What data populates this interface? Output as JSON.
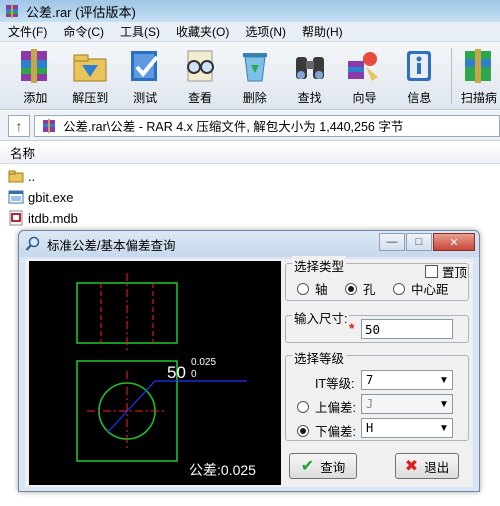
{
  "window": {
    "title": "公差.rar (评估版本)"
  },
  "menu": [
    "文件(F)",
    "命令(C)",
    "工具(S)",
    "收藏夹(O)",
    "选项(N)",
    "帮助(H)"
  ],
  "toolbar": {
    "buttons": [
      "添加",
      "解压到",
      "测试",
      "查看",
      "删除",
      "查找",
      "向导",
      "信息"
    ],
    "extra": "扫描病"
  },
  "address": {
    "text": "公差.rar\\公差 - RAR 4.x 压缩文件, 解包大小为 1,440,256 字节"
  },
  "filelist": {
    "column_name": "名称",
    "items": [
      "..",
      "gbit.exe",
      "itdb.mdb"
    ]
  },
  "dialog": {
    "title": "标准公差/基本偏差查询",
    "drawing": {
      "dimension": "50",
      "upper_dev": "0.025",
      "lower_dev": "0",
      "tolerance_label": "公差:0.025"
    },
    "type_group": {
      "title": "选择类型",
      "pin_label": "置顶",
      "options": [
        "轴",
        "孔",
        "中心距"
      ],
      "selected": "孔"
    },
    "size_group": {
      "title": "输入尺寸:",
      "required_mark": "*",
      "value": "50"
    },
    "grade_group": {
      "title": "选择等级",
      "it_label": "IT等级:",
      "it_value": "7",
      "upper_label": "上偏差:",
      "upper_value": "J",
      "lower_label": "下偏差:",
      "lower_value": "H",
      "selected": "下偏差"
    },
    "buttons": {
      "query": "查询",
      "exit": "退出"
    }
  },
  "colors": {
    "drawing_bg": "#000000",
    "outline": "#1fbf2a",
    "center_line": "#ff2020",
    "dimension_line": "#1f35ff",
    "text": "#ffffff"
  }
}
